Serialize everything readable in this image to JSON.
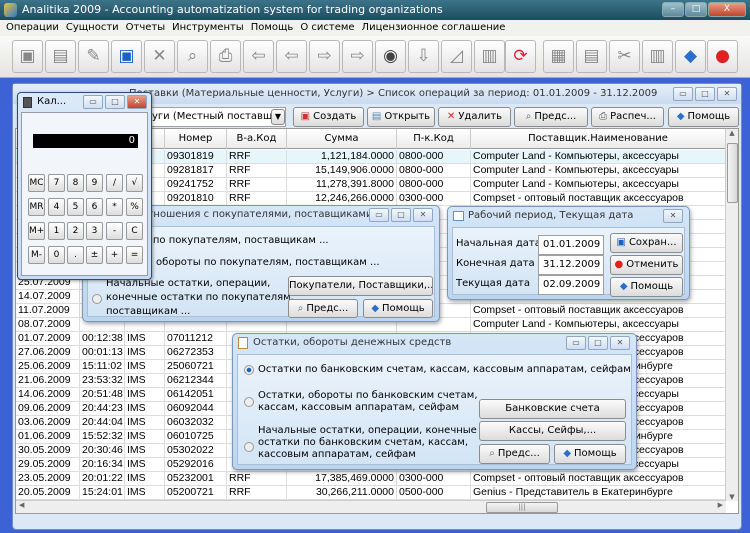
{
  "app": {
    "title": "Analitika 2009 - Accounting automatization system for trading organizations"
  },
  "menu": [
    "Операции",
    "Сущности",
    "Отчеты",
    "Инструменты",
    "Помощь",
    "О системе",
    "Лицензионное соглашение"
  ],
  "toolbar": {
    "icons": [
      "new-doc-icon",
      "open-folder-icon",
      "edit-icon",
      "save-icon",
      "delete-icon",
      "preview-icon",
      "print-icon",
      "first-icon",
      "prev-icon",
      "next-icon",
      "last-icon",
      "find-icon",
      "down-icon",
      "ruler-icon",
      "clipboard-icon",
      "refresh-icon",
      "calendar-icon",
      "calculator-icon",
      "tools-icon",
      "archive-icon",
      "help-book-icon",
      "exit-icon"
    ]
  },
  "mdi": {
    "title": "Поставки (Материальные ценности, Услуги) > Список операций за период: 01.01.2009 - 31.12.2009",
    "combo": "Услуги (Местный поставщик)",
    "buttons": {
      "create": "Создать",
      "open": "Открыть",
      "delete": "Удалить",
      "preview": "Предс...",
      "print": "Распеч...",
      "help": "Помощь"
    },
    "columns": [
      "Номер",
      "В-а.Код",
      "Сумма",
      "П-к.Код",
      "Поставщик.Наименование"
    ],
    "rows": [
      {
        "date": "",
        "time": "",
        "code": "",
        "num": "09301819",
        "cur": "RRF",
        "sum": "1,121,184.0000",
        "pk": "0800-000",
        "sup": "Computer Land - Компьютеры, аксессуары"
      },
      {
        "date": "",
        "time": "",
        "code": "",
        "num": "09281817",
        "cur": "RRF",
        "sum": "15,149,906.0000",
        "pk": "0800-000",
        "sup": "Computer Land - Компьютеры, аксессуары"
      },
      {
        "date": "",
        "time": "",
        "code": "",
        "num": "09241752",
        "cur": "RRF",
        "sum": "11,278,391.8000",
        "pk": "0800-000",
        "sup": "Computer Land - Компьютеры, аксессуары"
      },
      {
        "date": "",
        "time": "",
        "code": "",
        "num": "09201810",
        "cur": "RRF",
        "sum": "12,246,266.0000",
        "pk": "0300-000",
        "sup": "Compset - оптовый поставщик аксессуаров"
      },
      {
        "date": "",
        "time": "",
        "code": "",
        "num": "",
        "cur": "",
        "sum": "",
        "pk": "",
        "sup": ""
      },
      {
        "date": "",
        "time": "",
        "code": "",
        "num": "",
        "cur": "",
        "sum": "",
        "pk": "",
        "sup": "Genius - Представитель в Екатеринбурге"
      },
      {
        "date": "",
        "time": "",
        "code": "",
        "num": "",
        "cur": "",
        "sum": "",
        "pk": "",
        "sup": ""
      },
      {
        "date": "",
        "time": "",
        "code": "",
        "num": "",
        "cur": "",
        "sum": "",
        "pk": "",
        "sup": ""
      },
      {
        "date": "",
        "time": "",
        "code": "",
        "num": "",
        "cur": "",
        "sum": "",
        "pk": "",
        "sup": ""
      },
      {
        "date": "25.07.2009",
        "time": "",
        "code": "",
        "num": "",
        "cur": "",
        "sum": "",
        "pk": "",
        "sup": ""
      },
      {
        "date": "14.07.2009",
        "time": "",
        "code": "",
        "num": "",
        "cur": "",
        "sum": "",
        "pk": "",
        "sup": ""
      },
      {
        "date": "11.07.2009",
        "time": "",
        "code": "",
        "num": "",
        "cur": "",
        "sum": "",
        "pk": "",
        "sup": "Compset - оптовый поставщик аксессуаров"
      },
      {
        "date": "08.07.2009",
        "time": "",
        "code": "",
        "num": "",
        "cur": "",
        "sum": "",
        "pk": "",
        "sup": "Computer Land - Компьютеры, аксессуары"
      },
      {
        "date": "01.07.2009",
        "time": "00:12:38",
        "code": "IMS",
        "num": "07011212",
        "cur": "",
        "sum": "",
        "pk": "",
        "sup": "Compset - оптовый поставщик аксессуаров"
      },
      {
        "date": "27.06.2009",
        "time": "00:01:13",
        "code": "IMS",
        "num": "06272353",
        "cur": "",
        "sum": "",
        "pk": "",
        "sup": "Compset - оптовый поставщик аксессуаров"
      },
      {
        "date": "25.06.2009",
        "time": "15:11:02",
        "code": "IMS",
        "num": "25060721",
        "cur": "",
        "sum": "",
        "pk": "",
        "sup": "Genius - Представитель в Екатеринбурге"
      },
      {
        "date": "21.06.2009",
        "time": "23:53:32",
        "code": "IMS",
        "num": "06212344",
        "cur": "",
        "sum": "",
        "pk": "",
        "sup": "Compset - оптовый поставщик аксессуаров"
      },
      {
        "date": "14.06.2009",
        "time": "20:51:48",
        "code": "IMS",
        "num": "06142051",
        "cur": "",
        "sum": "",
        "pk": "",
        "sup": "Computer Land - Компьютеры, аксессуары"
      },
      {
        "date": "09.06.2009",
        "time": "20:44:23",
        "code": "IMS",
        "num": "06092044",
        "cur": "",
        "sum": "",
        "pk": "",
        "sup": "Compset - оптовый поставщик аксессуаров"
      },
      {
        "date": "03.06.2009",
        "time": "20:44:04",
        "code": "IMS",
        "num": "06032032",
        "cur": "",
        "sum": "",
        "pk": "",
        "sup": "Compset - оптовый поставщик аксессуаров"
      },
      {
        "date": "01.06.2009",
        "time": "15:52:32",
        "code": "IMS",
        "num": "06010725",
        "cur": "",
        "sum": "",
        "pk": "",
        "sup": "Genius - Представитель в Екатеринбурге"
      },
      {
        "date": "30.05.2009",
        "time": "20:30:46",
        "code": "IMS",
        "num": "05302022",
        "cur": "",
        "sum": "",
        "pk": "",
        "sup": "Compset - оптовый поставщик аксессуаров"
      },
      {
        "date": "29.05.2009",
        "time": "20:16:34",
        "code": "IMS",
        "num": "05292016",
        "cur": "",
        "sum": "",
        "pk": "",
        "sup": "Computer Land - Компьютеры, аксессуары"
      },
      {
        "date": "23.05.2009",
        "time": "20:01:22",
        "code": "IMS",
        "num": "05232001",
        "cur": "RRF",
        "sum": "17,385,469.0000",
        "pk": "0300-000",
        "sup": "Compset - оптовый поставщик аксессуаров"
      },
      {
        "date": "20.05.2009",
        "time": "15:24:01",
        "code": "IMS",
        "num": "05200721",
        "cur": "RRF",
        "sum": "30,266,211.0000",
        "pk": "0500-000",
        "sup": "Genius - Представитель в Екатеринбурге"
      },
      {
        "date": "14.05.2009",
        "time": "19:51:58",
        "code": "IMS",
        "num": "05141951",
        "cur": "RRF",
        "sum": "12,038,973.0000",
        "pk": "0300-000",
        "sup": "Compset - оптовый поставщик аксессуаров"
      }
    ]
  },
  "calculator": {
    "title": "Кал...",
    "display": "0",
    "keys": [
      [
        "MC",
        "7",
        "8",
        "9",
        "/",
        "√"
      ],
      [
        "MR",
        "4",
        "5",
        "6",
        "*",
        "%"
      ],
      [
        "M+",
        "1",
        "2",
        "3",
        "-",
        "C"
      ],
      [
        "M-",
        "0",
        ".",
        "±",
        "+",
        "="
      ]
    ]
  },
  "relations": {
    "title": "Взаимоотношения с покупателями, поставщиками...",
    "options": [
      "Остатки по покупателям, поставщикам ...",
      "Остатки, обороты по покупателям, поставщикам ..."
    ],
    "option3": [
      "Начальные остатки, операции,",
      "конечные остатки по покупателям,",
      "поставщикам ..."
    ],
    "buttons": {
      "partners": "Покупатели, Поставщики,...",
      "preview": "Предс...",
      "help": "Помощь"
    }
  },
  "period": {
    "title": "Рабочий период, Текущая дата",
    "start_label": "Начальная дата",
    "start": "01.01.2009",
    "end_label": "Конечная дата",
    "end": "31.12.2009",
    "current_label": "Текущая дата",
    "current": "02.09.2009",
    "buttons": {
      "save": "Сохран...",
      "cancel": "Отменить",
      "help": "Помощь"
    }
  },
  "money": {
    "title": "Остатки, обороты денежных средств",
    "option1": "Остатки по банковским счетам, кассам, кассовым аппаратам, сейфам",
    "option2": [
      "Остатки, обороты по банковским счетам,",
      "кассам, кассовым аппаратам, сейфам"
    ],
    "option3": [
      "Начальные остатки, операции, конечные",
      "остатки по банковским счетам, кассам,",
      "кассовым аппаратам, сейфам"
    ],
    "selected": 1,
    "buttons": {
      "bank": "Банковские счета",
      "cash": "Кассы, Сейфы,...",
      "preview": "Предс...",
      "help": "Помощь"
    }
  }
}
